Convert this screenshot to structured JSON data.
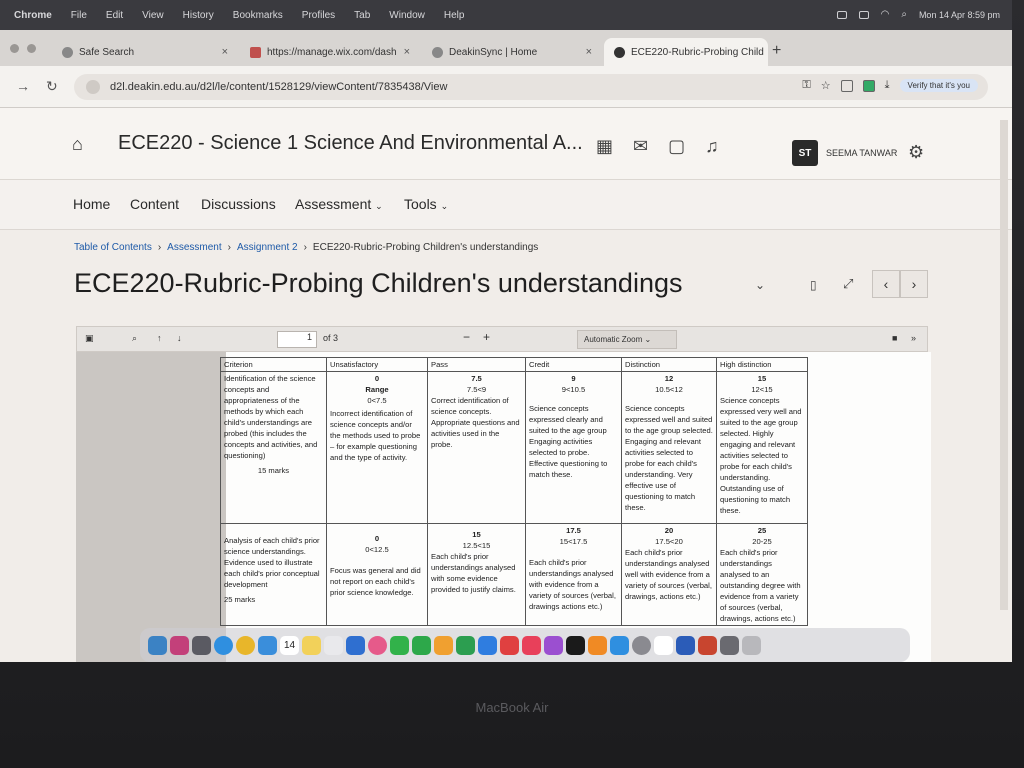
{
  "menubar": {
    "items": [
      "Chrome",
      "File",
      "Edit",
      "View",
      "History",
      "Bookmarks",
      "Profiles",
      "Tab",
      "Window",
      "Help"
    ],
    "clock": "Mon 14 Apr 8:59 pm"
  },
  "tabs": [
    {
      "label": "Safe Search"
    },
    {
      "label": "https://manage.wix.com/dash"
    },
    {
      "label": "DeakinSync | Home"
    },
    {
      "label": "ECE220-Rubric-Probing Child"
    }
  ],
  "address": {
    "url": "d2l.deakin.edu.au/d2l/le/content/1528129/viewContent/7835438/View",
    "verify": "Verify that it's you"
  },
  "header": {
    "course_title": "ECE220 - Science 1 Science And Environmental A...",
    "avatar_initials": "ST",
    "username": "SEEMA TANWAR"
  },
  "nav": {
    "home": "Home",
    "content": "Content",
    "discussions": "Discussions",
    "assessment": "Assessment",
    "tools": "Tools"
  },
  "breadcrumb": {
    "toc": "Table of Contents",
    "assessment": "Assessment",
    "assignment": "Assignment 2",
    "current": "ECE220-Rubric-Probing Children's understandings"
  },
  "page": {
    "title": "ECE220-Rubric-Probing Children's understandings"
  },
  "pdf": {
    "page_number": "1",
    "page_total": "of 3",
    "zoom": "Automatic Zoom"
  },
  "rubric": {
    "headers": [
      "Criterion",
      "Unsatisfactory",
      "Pass",
      "Credit",
      "Distinction",
      "High distinction"
    ],
    "row1": {
      "criterion": "Identification of the science concepts and appropriateness of the methods by which each child's understandings are probed (this includes the concepts and activities, and questioning)",
      "marks": "15 marks",
      "unsat_score": "0",
      "unsat_range_label": "Range",
      "unsat_range": "0<7.5",
      "unsat_desc": "Incorrect identification of science concepts and/or the methods used to probe – for example questioning and the type of activity.",
      "pass_score": "7.5",
      "pass_range": "7.5<9",
      "pass_desc": "Correct identification of science concepts. Appropriate questions and activities used in the probe.",
      "credit_score": "9",
      "credit_range": "9<10.5",
      "credit_desc": "Science concepts expressed clearly and suited to the age group Engaging activities selected to probe. Effective questioning to match these.",
      "dist_score": "12",
      "dist_range": "10.5<12",
      "dist_desc": "Science concepts expressed well and suited to the age group selected. Engaging and relevant activities selected to probe for each child's understanding. Very effective use of questioning to match these.",
      "hd_score": "15",
      "hd_range": "12<15",
      "hd_desc": "Science concepts expressed very well and suited to the age group selected. Highly engaging and relevant activities selected to probe for each child's understanding. Outstanding use of questioning to match these."
    },
    "row2": {
      "criterion": "Analysis of each child's prior science understandings. Evidence used to illustrate each child's prior conceptual development",
      "marks": "25 marks",
      "unsat_score": "0",
      "unsat_range": "0<12.5",
      "unsat_desc": "Focus was general and did not report on each child's prior science knowledge.",
      "pass_score": "15",
      "pass_range": "12.5<15",
      "pass_desc": "Each child's prior understandings analysed with some evidence provided to justify claims.",
      "credit_score": "17.5",
      "credit_range": "15<17.5",
      "credit_desc": "Each child's prior understandings analysed with evidence from a variety of sources (verbal, drawings actions etc.)",
      "dist_score": "20",
      "dist_range": "17.5<20",
      "dist_desc": "Each child's prior understandings analysed well with evidence from a variety of sources (verbal, drawings, actions etc.)",
      "hd_score": "25",
      "hd_range": "20-25",
      "hd_desc": "Each child's prior understandings analysed to an outstanding degree with evidence from a variety of sources (verbal, drawings, actions etc.)"
    }
  },
  "dock": {
    "calendar_day": "14"
  },
  "device": {
    "label": "MacBook Air"
  }
}
